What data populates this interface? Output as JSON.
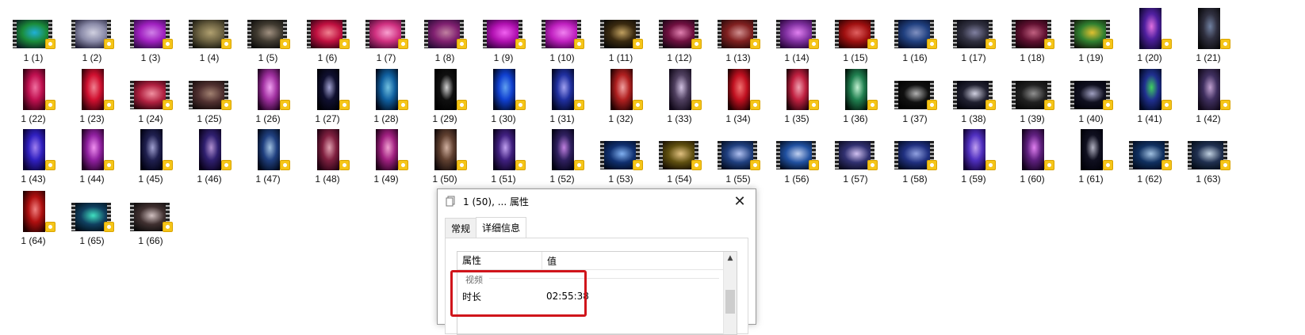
{
  "files": [
    {
      "label": "1 (1)",
      "orientation": "wide",
      "colors": [
        "#0a1520",
        "#1a8c3a",
        "#20b0d8"
      ]
    },
    {
      "label": "1 (2)",
      "orientation": "wide",
      "colors": [
        "#1a1830",
        "#8a8aa8",
        "#d0d0e0"
      ]
    },
    {
      "label": "1 (3)",
      "orientation": "wide",
      "colors": [
        "#2a0a40",
        "#a020c0",
        "#d080e8"
      ]
    },
    {
      "label": "1 (4)",
      "orientation": "wide",
      "colors": [
        "#10100a",
        "#6a6040",
        "#b0a070"
      ]
    },
    {
      "label": "1 (5)",
      "orientation": "wide",
      "colors": [
        "#080808",
        "#403a30",
        "#a09080"
      ]
    },
    {
      "label": "1 (6)",
      "orientation": "wide",
      "colors": [
        "#2a0010",
        "#c01040",
        "#f08090"
      ]
    },
    {
      "label": "1 (7)",
      "orientation": "wide",
      "colors": [
        "#400a30",
        "#d03080",
        "#f8a0d0"
      ]
    },
    {
      "label": "1 (8)",
      "orientation": "wide",
      "colors": [
        "#200a30",
        "#802070",
        "#c080a0"
      ]
    },
    {
      "label": "1 (9)",
      "orientation": "wide",
      "colors": [
        "#30003a",
        "#b010b0",
        "#f060f0"
      ]
    },
    {
      "label": "1 (10)",
      "orientation": "wide",
      "colors": [
        "#3a0040",
        "#c020c0",
        "#f080f0"
      ]
    },
    {
      "label": "1 (11)",
      "orientation": "wide",
      "colors": [
        "#050505",
        "#3a2a10",
        "#c0a060"
      ]
    },
    {
      "label": "1 (12)",
      "orientation": "wide",
      "colors": [
        "#100410",
        "#701040",
        "#e080b0"
      ]
    },
    {
      "label": "1 (13)",
      "orientation": "wide",
      "colors": [
        "#200808",
        "#802020",
        "#d09090"
      ]
    },
    {
      "label": "1 (14)",
      "orientation": "wide",
      "colors": [
        "#200030",
        "#8030a0",
        "#e080f0"
      ]
    },
    {
      "label": "1 (15)",
      "orientation": "wide",
      "colors": [
        "#200000",
        "#a01010",
        "#e06060"
      ]
    },
    {
      "label": "1 (16)",
      "orientation": "wide",
      "colors": [
        "#050a20",
        "#204080",
        "#8090c0"
      ]
    },
    {
      "label": "1 (17)",
      "orientation": "wide",
      "colors": [
        "#08080e",
        "#303040",
        "#8080a0"
      ]
    },
    {
      "label": "1 (18)",
      "orientation": "wide",
      "colors": [
        "#100008",
        "#601030",
        "#c06080"
      ]
    },
    {
      "label": "1 (19)",
      "orientation": "wide",
      "colors": [
        "#101008",
        "#308030",
        "#e0c030"
      ]
    },
    {
      "label": "1 (20)",
      "orientation": "tall",
      "colors": [
        "#100830",
        "#5020a0",
        "#e070e0"
      ]
    },
    {
      "label": "1 (21)",
      "orientation": "tall",
      "colors": [
        "#08080a",
        "#303040",
        "#7080a0"
      ]
    },
    {
      "label": "1 (22)",
      "orientation": "tall",
      "colors": [
        "#300010",
        "#c01050",
        "#f070a0"
      ]
    },
    {
      "label": "1 (23)",
      "orientation": "tall",
      "colors": [
        "#300008",
        "#d01030",
        "#f08090"
      ]
    },
    {
      "label": "1 (24)",
      "orientation": "wide",
      "colors": [
        "#200008",
        "#b02040",
        "#f090a0"
      ]
    },
    {
      "label": "1 (25)",
      "orientation": "wide",
      "colors": [
        "#100808",
        "#503030",
        "#a08070"
      ]
    },
    {
      "label": "1 (26)",
      "orientation": "tall",
      "colors": [
        "#200020",
        "#a030a0",
        "#f0a0f0"
      ]
    },
    {
      "label": "1 (27)",
      "orientation": "tall",
      "colors": [
        "#000005",
        "#101030",
        "#a0a0d0"
      ]
    },
    {
      "label": "1 (28)",
      "orientation": "tall",
      "colors": [
        "#000818",
        "#1060a0",
        "#70c0e0"
      ]
    },
    {
      "label": "1 (29)",
      "orientation": "tall",
      "colors": [
        "#000000",
        "#101010",
        "#d0d0d0"
      ]
    },
    {
      "label": "1 (30)",
      "orientation": "tall",
      "colors": [
        "#000820",
        "#1040d0",
        "#60a0f0"
      ]
    },
    {
      "label": "1 (31)",
      "orientation": "tall",
      "colors": [
        "#000420",
        "#2030a0",
        "#a0a0f0"
      ]
    },
    {
      "label": "1 (32)",
      "orientation": "tall",
      "colors": [
        "#200000",
        "#b02020",
        "#f0a0a0"
      ]
    },
    {
      "label": "1 (33)",
      "orientation": "tall",
      "colors": [
        "#100818",
        "#504060",
        "#d0c0e0"
      ]
    },
    {
      "label": "1 (34)",
      "orientation": "tall",
      "colors": [
        "#200000",
        "#c01020",
        "#f07070"
      ]
    },
    {
      "label": "1 (35)",
      "orientation": "tall",
      "colors": [
        "#200008",
        "#c02040",
        "#f0a0b0"
      ]
    },
    {
      "label": "1 (36)",
      "orientation": "tall",
      "colors": [
        "#001008",
        "#208050",
        "#c0f0d0"
      ]
    },
    {
      "label": "1 (37)",
      "orientation": "wide",
      "colors": [
        "#000000",
        "#101010",
        "#b0b0b0"
      ]
    },
    {
      "label": "1 (38)",
      "orientation": "wide",
      "colors": [
        "#000008",
        "#202030",
        "#d0d0e0"
      ]
    },
    {
      "label": "1 (39)",
      "orientation": "wide",
      "colors": [
        "#050505",
        "#202020",
        "#909090"
      ]
    },
    {
      "label": "1 (40)",
      "orientation": "wide",
      "colors": [
        "#000008",
        "#101020",
        "#a0a0c0"
      ]
    },
    {
      "label": "1 (41)",
      "orientation": "tall",
      "colors": [
        "#000820",
        "#203090",
        "#40d060"
      ]
    },
    {
      "label": "1 (42)",
      "orientation": "tall",
      "colors": [
        "#100818",
        "#403060",
        "#c0a0d0"
      ]
    },
    {
      "label": "1 (43)",
      "orientation": "tall",
      "colors": [
        "#080030",
        "#3020c0",
        "#a080f0"
      ]
    },
    {
      "label": "1 (44)",
      "orientation": "tall",
      "colors": [
        "#200020",
        "#9020a0",
        "#f090f0"
      ]
    },
    {
      "label": "1 (45)",
      "orientation": "tall",
      "colors": [
        "#000010",
        "#202050",
        "#a0a0d0"
      ]
    },
    {
      "label": "1 (46)",
      "orientation": "tall",
      "colors": [
        "#080018",
        "#302070",
        "#b090d0"
      ]
    },
    {
      "label": "1 (47)",
      "orientation": "tall",
      "colors": [
        "#000818",
        "#204080",
        "#a0c0e0"
      ]
    },
    {
      "label": "1 (48)",
      "orientation": "tall",
      "colors": [
        "#200010",
        "#802040",
        "#e0a0b0"
      ]
    },
    {
      "label": "1 (49)",
      "orientation": "tall",
      "colors": [
        "#200018",
        "#a02080",
        "#f0a0d0"
      ]
    },
    {
      "label": "1 (50)",
      "orientation": "tall",
      "colors": [
        "#100808",
        "#604030",
        "#d0b0a0"
      ]
    },
    {
      "label": "1 (51)",
      "orientation": "tall",
      "colors": [
        "#080018",
        "#402080",
        "#c0a0f0"
      ]
    },
    {
      "label": "1 (52)",
      "orientation": "tall",
      "colors": [
        "#000010",
        "#302060",
        "#c080e0"
      ]
    },
    {
      "label": "1 (53)",
      "orientation": "wide",
      "colors": [
        "#000818",
        "#103070",
        "#80b0f0"
      ]
    },
    {
      "label": "1 (54)",
      "orientation": "wide",
      "colors": [
        "#100800",
        "#605010",
        "#e0c080"
      ]
    },
    {
      "label": "1 (55)",
      "orientation": "wide",
      "colors": [
        "#000818",
        "#204080",
        "#b0c0f0"
      ]
    },
    {
      "label": "1 (56)",
      "orientation": "wide",
      "colors": [
        "#000818",
        "#2050a0",
        "#c0d0f0"
      ]
    },
    {
      "label": "1 (57)",
      "orientation": "wide",
      "colors": [
        "#080818",
        "#303070",
        "#d0c0f0"
      ]
    },
    {
      "label": "1 (58)",
      "orientation": "wide",
      "colors": [
        "#000818",
        "#203080",
        "#90a0e0"
      ]
    },
    {
      "label": "1 (59)",
      "orientation": "tall",
      "colors": [
        "#100030",
        "#5030c0",
        "#c0a0f0"
      ]
    },
    {
      "label": "1 (60)",
      "orientation": "tall",
      "colors": [
        "#100018",
        "#602080",
        "#e080f0"
      ]
    },
    {
      "label": "1 (61)",
      "orientation": "tall",
      "colors": [
        "#000008",
        "#101020",
        "#b0b0c0"
      ]
    },
    {
      "label": "1 (62)",
      "orientation": "wide",
      "colors": [
        "#000818",
        "#103060",
        "#a0c0e0"
      ]
    },
    {
      "label": "1 (63)",
      "orientation": "wide",
      "colors": [
        "#000810",
        "#203050",
        "#c0d0e0"
      ]
    },
    {
      "label": "1 (64)",
      "orientation": "tall",
      "colors": [
        "#200000",
        "#b01010",
        "#f08080"
      ]
    },
    {
      "label": "1 (65)",
      "orientation": "wide",
      "colors": [
        "#000810",
        "#104060",
        "#40e0c0"
      ]
    },
    {
      "label": "1 (66)",
      "orientation": "wide",
      "colors": [
        "#080808",
        "#403030",
        "#d0c0c0"
      ]
    }
  ],
  "dialog": {
    "title": "1 (50), ... 属性",
    "close_glyph": "✕",
    "tabs": [
      {
        "label": "常规",
        "active": false
      },
      {
        "label": "详细信息",
        "active": true
      }
    ],
    "columns": {
      "property": "属性",
      "value": "值"
    },
    "group_label": "视频",
    "rows": [
      {
        "key": "时长",
        "value": "02:55:38"
      }
    ],
    "highlight_color": "#d0151b"
  }
}
